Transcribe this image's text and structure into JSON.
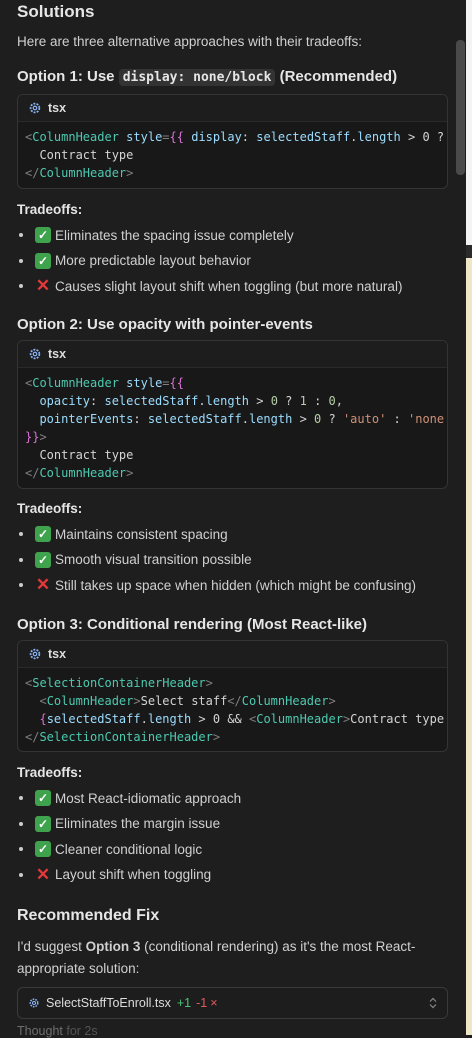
{
  "title": "Solutions",
  "intro": "Here are three alternative approaches with their tradeoffs:",
  "options": [
    {
      "heading_prefix": "Option 1: Use ",
      "heading_code": "display: none/block",
      "heading_suffix": " (Recommended)",
      "code_lang": "tsx",
      "code_lines": [
        [
          [
            "t-punct",
            "<"
          ],
          [
            "t-tag",
            "ColumnHeader"
          ],
          [
            "t-text",
            " "
          ],
          [
            "t-attr",
            "style"
          ],
          [
            "t-punct",
            "="
          ],
          [
            "t-brace",
            "{{"
          ],
          [
            "t-text",
            " "
          ],
          [
            "t-attr",
            "display"
          ],
          [
            "t-text",
            ": "
          ],
          [
            "t-attr",
            "selectedStaff"
          ],
          [
            "t-text",
            "."
          ],
          [
            "t-attr",
            "length"
          ],
          [
            "t-text",
            " > 0 ? "
          ]
        ],
        [
          [
            "t-text",
            "  Contract type"
          ]
        ],
        [
          [
            "t-punct",
            "</"
          ],
          [
            "t-tag",
            "ColumnHeader"
          ],
          [
            "t-punct",
            ">"
          ]
        ]
      ],
      "tradeoffs_label": "Tradeoffs:",
      "tradeoffs": [
        {
          "icon": "check",
          "text": "Eliminates the spacing issue completely"
        },
        {
          "icon": "check",
          "text": "More predictable layout behavior"
        },
        {
          "icon": "cross",
          "text": "Causes slight layout shift when toggling (but more natural)"
        }
      ]
    },
    {
      "heading_prefix": "Option 2: Use opacity with pointer-events",
      "heading_code": "",
      "heading_suffix": "",
      "code_lang": "tsx",
      "code_lines": [
        [
          [
            "t-punct",
            "<"
          ],
          [
            "t-tag",
            "ColumnHeader"
          ],
          [
            "t-text",
            " "
          ],
          [
            "t-attr",
            "style"
          ],
          [
            "t-punct",
            "="
          ],
          [
            "t-brace",
            "{{"
          ]
        ],
        [
          [
            "t-text",
            "  "
          ],
          [
            "t-attr",
            "opacity"
          ],
          [
            "t-text",
            ": "
          ],
          [
            "t-attr",
            "selectedStaff"
          ],
          [
            "t-text",
            "."
          ],
          [
            "t-attr",
            "length"
          ],
          [
            "t-text",
            " > "
          ],
          [
            "t-num",
            "0"
          ],
          [
            "t-text",
            " ? "
          ],
          [
            "t-num",
            "1"
          ],
          [
            "t-text",
            " : "
          ],
          [
            "t-num",
            "0"
          ],
          [
            "t-text",
            ","
          ]
        ],
        [
          [
            "t-text",
            "  "
          ],
          [
            "t-attr",
            "pointerEvents"
          ],
          [
            "t-text",
            ": "
          ],
          [
            "t-attr",
            "selectedStaff"
          ],
          [
            "t-text",
            "."
          ],
          [
            "t-attr",
            "length"
          ],
          [
            "t-text",
            " > "
          ],
          [
            "t-num",
            "0"
          ],
          [
            "t-text",
            " ? "
          ],
          [
            "t-str",
            "'auto'"
          ],
          [
            "t-text",
            " : "
          ],
          [
            "t-str",
            "'none"
          ]
        ],
        [
          [
            "t-brace",
            "}}"
          ],
          [
            "t-punct",
            ">"
          ]
        ],
        [
          [
            "t-text",
            "  Contract type"
          ]
        ],
        [
          [
            "t-punct",
            "</"
          ],
          [
            "t-tag",
            "ColumnHeader"
          ],
          [
            "t-punct",
            ">"
          ]
        ]
      ],
      "tradeoffs_label": "Tradeoffs:",
      "tradeoffs": [
        {
          "icon": "check",
          "text": "Maintains consistent spacing"
        },
        {
          "icon": "check",
          "text": "Smooth visual transition possible"
        },
        {
          "icon": "cross",
          "text": "Still takes up space when hidden (which might be confusing)"
        }
      ]
    },
    {
      "heading_prefix": "Option 3: Conditional rendering (Most React-like)",
      "heading_code": "",
      "heading_suffix": "",
      "code_lang": "tsx",
      "code_lines": [
        [
          [
            "t-punct",
            "<"
          ],
          [
            "t-tag",
            "SelectionContainerHeader"
          ],
          [
            "t-punct",
            ">"
          ]
        ],
        [
          [
            "t-text",
            "  "
          ],
          [
            "t-punct",
            "<"
          ],
          [
            "t-tag",
            "ColumnHeader"
          ],
          [
            "t-punct",
            ">"
          ],
          [
            "t-text",
            "Select staff"
          ],
          [
            "t-punct",
            "</"
          ],
          [
            "t-tag",
            "ColumnHeader"
          ],
          [
            "t-punct",
            ">"
          ]
        ],
        [
          [
            "t-text",
            "  "
          ],
          [
            "t-brace",
            "{"
          ],
          [
            "t-attr",
            "selectedStaff"
          ],
          [
            "t-text",
            "."
          ],
          [
            "t-attr",
            "length"
          ],
          [
            "t-text",
            " > 0 && "
          ],
          [
            "t-punct",
            "<"
          ],
          [
            "t-tag",
            "ColumnHeader"
          ],
          [
            "t-punct",
            ">"
          ],
          [
            "t-text",
            "Contract type"
          ]
        ],
        [
          [
            "t-punct",
            "</"
          ],
          [
            "t-tag",
            "SelectionContainerHeader"
          ],
          [
            "t-punct",
            ">"
          ]
        ]
      ],
      "tradeoffs_label": "Tradeoffs:",
      "tradeoffs": [
        {
          "icon": "check",
          "text": "Most React-idiomatic approach"
        },
        {
          "icon": "check",
          "text": "Eliminates the margin issue"
        },
        {
          "icon": "check",
          "text": "Cleaner conditional logic"
        },
        {
          "icon": "cross",
          "text": "Layout shift when toggling"
        }
      ]
    }
  ],
  "recommended": {
    "heading": "Recommended Fix",
    "text_before": "I'd suggest ",
    "text_bold": "Option 3",
    "text_after": " (conditional rendering) as it's the most React-appropriate solution:"
  },
  "file_chip": {
    "filename": "SelectStaffToEnroll.tsx",
    "added": "+1",
    "removed": "-1",
    "close": "×",
    "expand_icon": "chevron-up-down-icon"
  },
  "thought": {
    "label": "Thought",
    "duration": "for 2s"
  },
  "colors": {
    "background": "#1e1e1e",
    "check": "#3fa34d",
    "cross": "#e5383b",
    "added": "#4ec07a",
    "removed": "#e05a5a"
  }
}
